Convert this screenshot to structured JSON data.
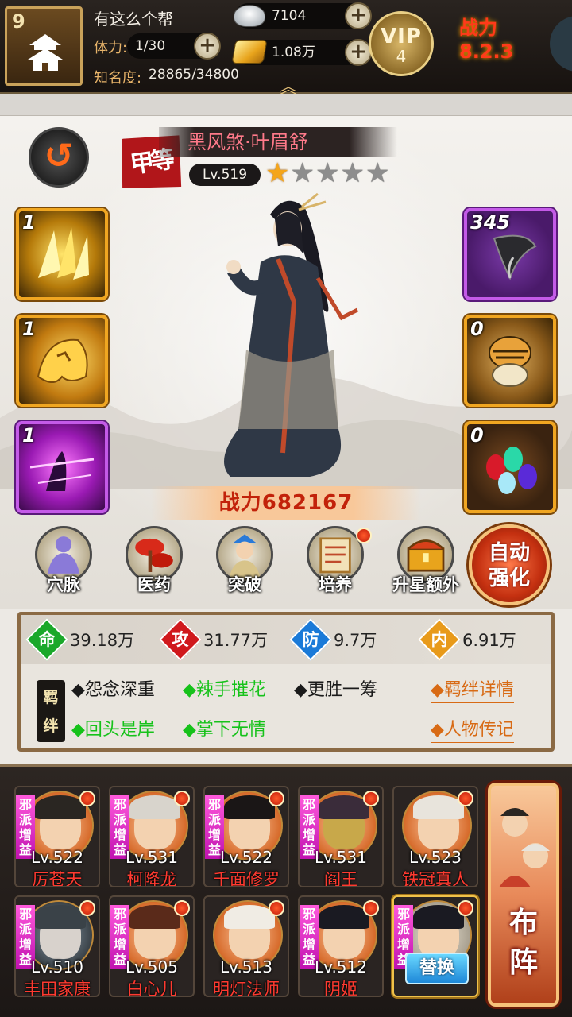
{
  "topbar": {
    "guild_level": "9",
    "guild_name": "有这么个帮",
    "stamina_label": "体力:",
    "stamina_value": "1/30",
    "fame_label": "知名度:",
    "fame_value": "28865/34800",
    "silver": "7104",
    "gold": "1.08万",
    "vip_label": "VIP",
    "vip_level": "4",
    "power_flair": "战力 8.2.3"
  },
  "hero": {
    "grade": "甲等",
    "name": "黑风煞·叶眉舒",
    "level": "Lv.519",
    "stars_total": 5,
    "stars_filled": 1,
    "power_label": "战力",
    "power_value": "682167"
  },
  "skills_left": [
    {
      "count": "1",
      "icon": "gold-shards-icon"
    },
    {
      "count": "1",
      "icon": "golden-tiger-icon"
    },
    {
      "count": "1",
      "icon": "purple-strike-icon"
    }
  ],
  "equip_right": [
    {
      "count": "345",
      "icon": "iron-claw-icon"
    },
    {
      "count": "0",
      "icon": "tiger-belt-icon"
    },
    {
      "count": "0",
      "icon": "gems-icon"
    }
  ],
  "functions": [
    {
      "label": "穴脉",
      "badge": false
    },
    {
      "label": "医药",
      "badge": false
    },
    {
      "label": "突破",
      "badge": false
    },
    {
      "label": "培养",
      "badge": true
    },
    {
      "label": "升星额外",
      "badge": false
    }
  ],
  "auto_enhance": {
    "line1": "自动",
    "line2": "强化"
  },
  "stats": [
    {
      "char": "命",
      "value": "39.18万",
      "color": "#1aa82a"
    },
    {
      "char": "攻",
      "value": "31.77万",
      "color": "#d0181c"
    },
    {
      "char": "防",
      "value": "9.7万",
      "color": "#1a7ad8"
    },
    {
      "char": "内",
      "value": "6.91万",
      "color": "#e89a1a"
    }
  ],
  "bond_badge": "羁绊",
  "bonds": [
    {
      "text": "◆怨念深重",
      "active": false
    },
    {
      "text": "◆辣手摧花",
      "active": true
    },
    {
      "text": "◆更胜一筹",
      "active": false
    },
    {
      "text": "◆回头是岸",
      "active": true
    },
    {
      "text": "◆掌下无情",
      "active": true
    }
  ],
  "links": {
    "bond_detail": "◆羁绊详情",
    "biography": "◆人物传记"
  },
  "roster": [
    {
      "level": "Lv.522",
      "name": "厉苍天",
      "evil": true,
      "hair": "#2a2622"
    },
    {
      "level": "Lv.531",
      "name": "柯降龙",
      "evil": true,
      "hair": "#d8d4cc"
    },
    {
      "level": "Lv.522",
      "name": "千面修罗",
      "evil": true,
      "hair": "#1a1616"
    },
    {
      "level": "Lv.531",
      "name": "阎王",
      "evil": true,
      "hair": "#3a2c3a"
    },
    {
      "level": "Lv.523",
      "name": "铁冠真人",
      "evil": false,
      "hair": "#e8e4dc"
    },
    {
      "level": "Lv.510",
      "name": "丰田家康",
      "evil": true,
      "hair": "#3a4248"
    },
    {
      "level": "Lv.505",
      "name": "白心儿",
      "evil": true,
      "hair": "#5a2a1a"
    },
    {
      "level": "Lv.513",
      "name": "明灯法师",
      "evil": false,
      "hair": "#f0ece4"
    },
    {
      "level": "Lv.512",
      "name": "阴姬",
      "evil": true,
      "hair": "#1a1a22"
    }
  ],
  "evil_tag": "邪派增益",
  "swap_label": "替换",
  "formation": {
    "line1": "布",
    "line2": "阵"
  }
}
